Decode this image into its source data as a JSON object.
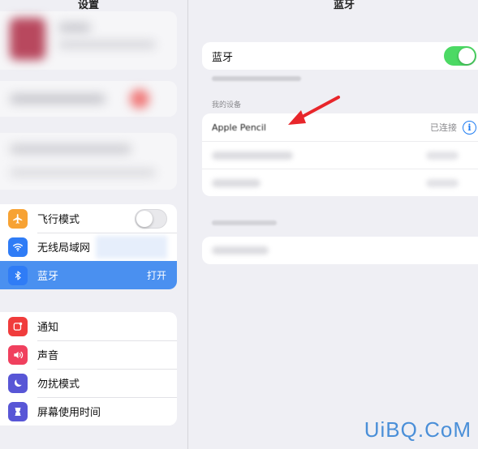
{
  "sidebar": {
    "title": "设置",
    "items_group1": [
      {
        "icon": "airplane-icon",
        "label": "飞行模式",
        "value": "",
        "toggle": false
      },
      {
        "icon": "wifi-icon",
        "label": "无线局域网",
        "value": ""
      },
      {
        "icon": "bluetooth-icon",
        "label": "蓝牙",
        "value": "打开"
      }
    ],
    "items_group2": [
      {
        "icon": "notifications-icon",
        "label": "通知"
      },
      {
        "icon": "sounds-icon",
        "label": "声音"
      },
      {
        "icon": "moon-icon",
        "label": "勿扰模式"
      },
      {
        "icon": "hourglass-icon",
        "label": "屏幕使用时间"
      }
    ]
  },
  "detail": {
    "title": "蓝牙",
    "bluetooth_label": "蓝牙",
    "bluetooth_on": true,
    "section_my_devices": "我的设备",
    "device_name": "Apple Pencil",
    "device_status": "已连接"
  },
  "colors": {
    "accent": "#4a90f0",
    "toggle_on": "#4cd964",
    "info_blue": "#1e7cf2",
    "airplane": "#f7a233",
    "wifi": "#2f7cf6",
    "bluetooth": "#2f7cf6",
    "notifications": "#f03c3c",
    "sounds": "#f0405e",
    "moon": "#5856d6",
    "hourglass": "#5856d6"
  },
  "watermark": "UiBQ.CoM"
}
